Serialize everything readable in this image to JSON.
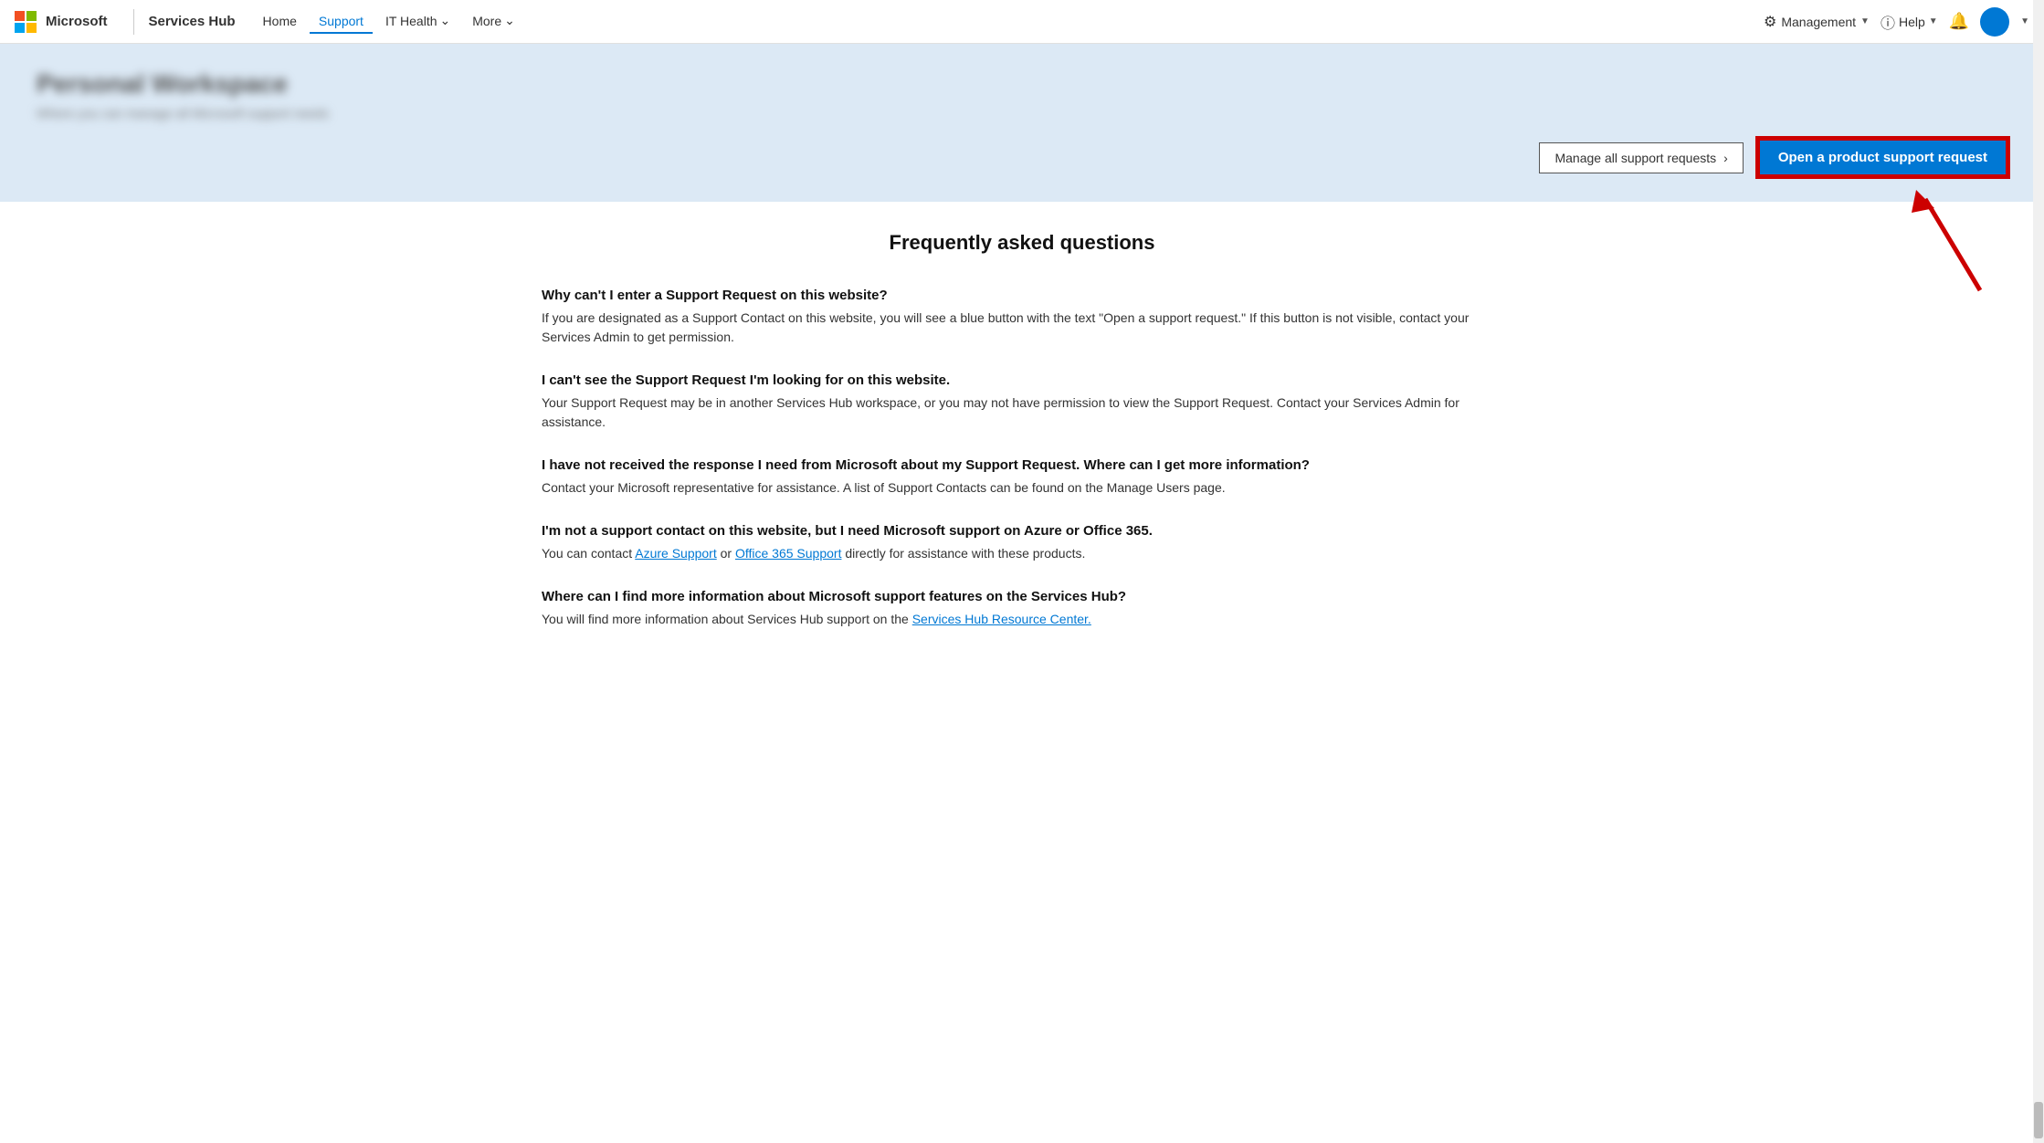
{
  "brand": {
    "company": "Microsoft",
    "app": "Services Hub"
  },
  "navbar": {
    "links": [
      {
        "label": "Home",
        "active": false
      },
      {
        "label": "Support",
        "active": true
      },
      {
        "label": "IT Health",
        "hasArrow": true
      },
      {
        "label": "More",
        "hasArrow": true
      }
    ],
    "management_label": "Management",
    "help_label": "Help"
  },
  "hero": {
    "title": "Personal Workspace",
    "subtitle": "Where you can manage all Microsoft support needs",
    "manage_btn": "Manage all support requests",
    "open_support_btn": "Open a product support request"
  },
  "faq": {
    "title": "Frequently asked questions",
    "items": [
      {
        "question": "Why can't I enter a Support Request on this website?",
        "answer": "If you are designated as a Support Contact on this website, you will see a blue button with the text \"Open a support request.\" If this button is not visible, contact your Services Admin to get permission.",
        "links": []
      },
      {
        "question": "I can't see the Support Request I'm looking for on this website.",
        "answer": "Your Support Request may be in another Services Hub workspace, or you may not have permission to view the Support Request. Contact your Services Admin for assistance.",
        "links": []
      },
      {
        "question": "I have not received the response I need from Microsoft about my Support Request. Where can I get more information?",
        "answer": "Contact your Microsoft representative for assistance. A list of Support Contacts can be found on the Manage Users page.",
        "links": []
      },
      {
        "question": "I'm not a support contact on this website, but I need Microsoft support on Azure or Office 365.",
        "answer_before": "You can contact ",
        "answer_link1": "Azure Support",
        "answer_middle": " or ",
        "answer_link2": "Office 365 Support",
        "answer_after": " directly for assistance with these products.",
        "links": [
          "Azure Support",
          "Office 365 Support"
        ]
      },
      {
        "question": "Where can I find more information about Microsoft support features on the Services Hub?",
        "answer_before": "You will find more information about Services Hub support on the ",
        "answer_link1": "Services Hub Resource Center.",
        "answer_after": "",
        "links": [
          "Services Hub Resource Center."
        ]
      }
    ]
  }
}
